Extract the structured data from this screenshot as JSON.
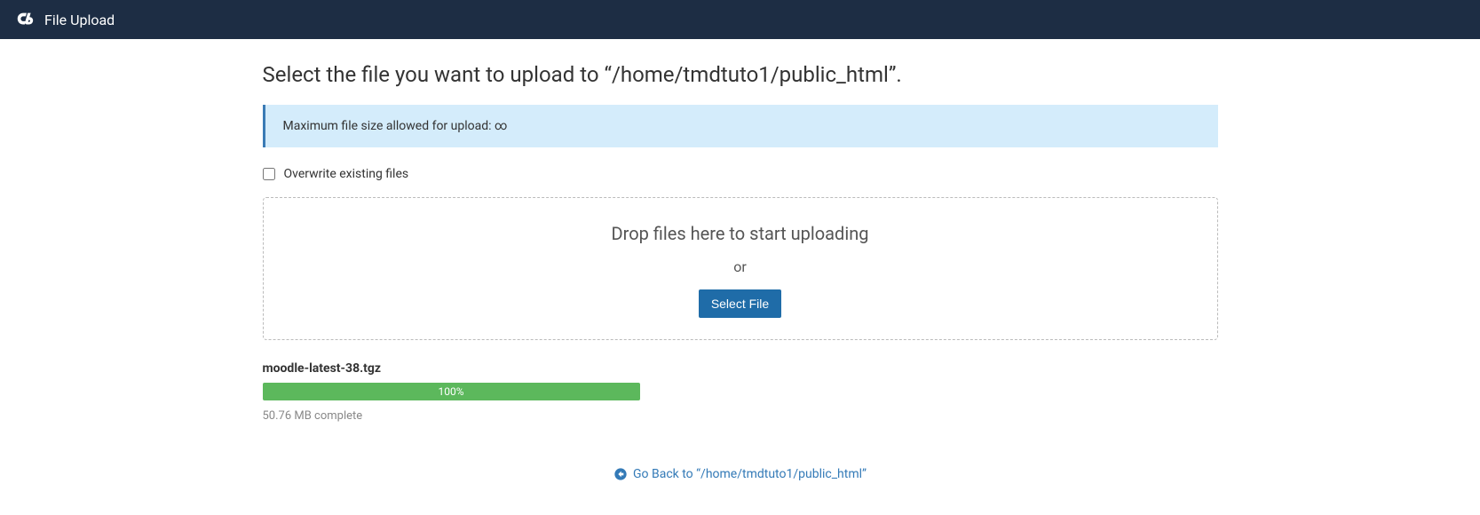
{
  "header": {
    "title": "File Upload"
  },
  "main": {
    "heading": "Select the file you want to upload to “/home/tmdtuto1/public_html”.",
    "info_banner": "Maximum file size allowed for upload: ∞",
    "overwrite_label": "Overwrite existing files",
    "dropzone": {
      "drop_text": "Drop files here to start uploading",
      "or_text": "or",
      "select_button": "Select File"
    },
    "upload": {
      "filename": "moodle-latest-38.tgz",
      "percent": "100%",
      "percent_value": 100,
      "complete_text": "50.76 MB complete"
    },
    "back_link": "Go Back to “/home/tmdtuto1/public_html”"
  }
}
